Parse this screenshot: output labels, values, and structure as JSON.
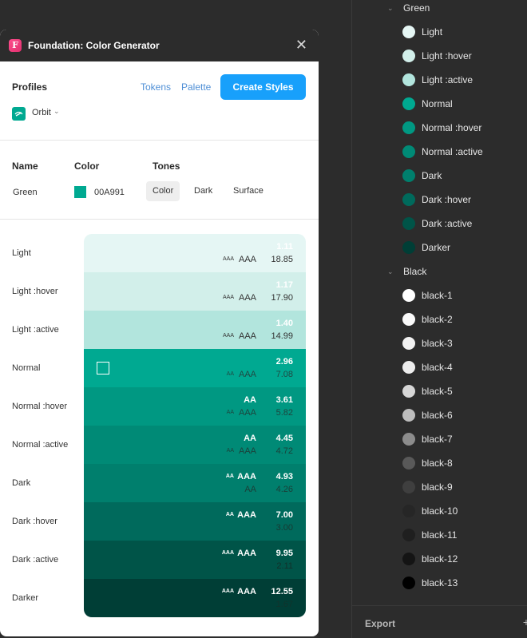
{
  "plugin": {
    "title": "Foundation: Color Generator",
    "logo_letter": "F",
    "close_glyph": "✕",
    "profiles_label": "Profiles",
    "tokens_link": "Tokens",
    "palette_link": "Palette",
    "create_styles_button": "Create Styles",
    "profile_value": "Orbit",
    "headers": {
      "name": "Name",
      "color": "Color",
      "tones": "Tones"
    },
    "color_entry": {
      "name": "Green",
      "hex": "00A991",
      "swatch_color": "#00A991"
    },
    "tone_tabs": [
      {
        "label": "Color",
        "active": true
      },
      {
        "label": "Dark",
        "active": false
      },
      {
        "label": "Surface",
        "active": false
      }
    ],
    "tones": [
      {
        "label": "Light",
        "bg": "#e5f6f4",
        "top_badge_sm": "",
        "top_badge_lg": "",
        "ratio_top": "1.11",
        "bot_badge_sm": "AAA",
        "bot_badge_lg": "AAA",
        "ratio_bottom": "18.85",
        "top_color": "#ffffff",
        "bottom_color": "#333333"
      },
      {
        "label": "Light :hover",
        "bg": "#d2efea",
        "top_badge_sm": "",
        "top_badge_lg": "",
        "ratio_top": "1.17",
        "bot_badge_sm": "AAA",
        "bot_badge_lg": "AAA",
        "ratio_bottom": "17.90",
        "top_color": "#ffffff",
        "bottom_color": "#333333"
      },
      {
        "label": "Light :active",
        "bg": "#b2e5dd",
        "top_badge_sm": "",
        "top_badge_lg": "",
        "ratio_top": "1.40",
        "bot_badge_sm": "AAA",
        "bot_badge_lg": "AAA",
        "ratio_bottom": "14.99",
        "top_color": "#ffffff",
        "bottom_color": "#333333"
      },
      {
        "label": "Normal",
        "bg": "#00a991",
        "top_badge_sm": "",
        "top_badge_lg": "",
        "ratio_top": "2.96",
        "bot_badge_sm": "AA",
        "bot_badge_lg": "AAA",
        "ratio_bottom": "7.08",
        "top_color": "#ffffff",
        "bottom_color": "#1f4a44",
        "selected": true
      },
      {
        "label": "Normal :hover",
        "bg": "#009882",
        "top_badge_sm": "",
        "top_badge_lg": "AA",
        "ratio_top": "3.61",
        "bot_badge_sm": "AA",
        "bot_badge_lg": "AAA",
        "ratio_bottom": "5.82",
        "top_color": "#ffffff",
        "bottom_color": "#1d463f"
      },
      {
        "label": "Normal :active",
        "bg": "#008a76",
        "top_badge_sm": "",
        "top_badge_lg": "AA",
        "ratio_top": "4.45",
        "bot_badge_sm": "AA",
        "bot_badge_lg": "AAA",
        "ratio_bottom": "4.72",
        "top_color": "#ffffff",
        "bottom_color": "#1b423b"
      },
      {
        "label": "Dark",
        "bg": "#007f6d",
        "top_badge_sm": "AA",
        "top_badge_lg": "AAA",
        "ratio_top": "4.93",
        "bot_badge_sm": "",
        "bot_badge_lg": "AA",
        "ratio_bottom": "4.26",
        "top_color": "#ffffff",
        "bottom_color": "#1a3f38"
      },
      {
        "label": "Dark :hover",
        "bg": "#006a5c",
        "top_badge_sm": "AA",
        "top_badge_lg": "AAA",
        "ratio_top": "7.00",
        "bot_badge_sm": "",
        "bot_badge_lg": "",
        "ratio_bottom": "3.00",
        "top_color": "#ffffff",
        "bottom_color": "#173a33"
      },
      {
        "label": "Dark :active",
        "bg": "#005448",
        "top_badge_sm": "AAA",
        "top_badge_lg": "AAA",
        "ratio_top": "9.95",
        "bot_badge_sm": "",
        "bot_badge_lg": "",
        "ratio_bottom": "2.11",
        "top_color": "#ffffff",
        "bottom_color": "#12302a"
      },
      {
        "label": "Darker",
        "bg": "#003e36",
        "top_badge_sm": "AAA",
        "top_badge_lg": "AAA",
        "ratio_top": "12.55",
        "bot_badge_sm": "",
        "bot_badge_lg": "",
        "ratio_bottom": "1.67",
        "top_color": "#ffffff",
        "bottom_color": "#10332c"
      }
    ]
  },
  "styles_panel": {
    "groups": [
      {
        "name": "Green",
        "chevron": "⌄",
        "items": [
          {
            "label": "Light",
            "color": "#e5f6f4"
          },
          {
            "label": "Light :hover",
            "color": "#d2efea"
          },
          {
            "label": "Light :active",
            "color": "#b2e5dd"
          },
          {
            "label": "Normal",
            "color": "#00a991"
          },
          {
            "label": "Normal :hover",
            "color": "#009882"
          },
          {
            "label": "Normal :active",
            "color": "#008a76"
          },
          {
            "label": "Dark",
            "color": "#007f6d"
          },
          {
            "label": "Dark :hover",
            "color": "#006a5c"
          },
          {
            "label": "Dark :active",
            "color": "#005448"
          },
          {
            "label": "Darker",
            "color": "#003e36"
          }
        ]
      },
      {
        "name": "Black",
        "chevron": "⌄",
        "items": [
          {
            "label": "black-1",
            "color": "#ffffff"
          },
          {
            "label": "black-2",
            "color": "#fafafa"
          },
          {
            "label": "black-3",
            "color": "#f2f2f2"
          },
          {
            "label": "black-4",
            "color": "#ededed"
          },
          {
            "label": "black-5",
            "color": "#d6d6d6"
          },
          {
            "label": "black-6",
            "color": "#bdbdbd"
          },
          {
            "label": "black-7",
            "color": "#8c8c8c"
          },
          {
            "label": "black-8",
            "color": "#595959"
          },
          {
            "label": "black-9",
            "color": "#3f3f3f"
          },
          {
            "label": "black-10",
            "color": "#262626"
          },
          {
            "label": "black-11",
            "color": "#1f1f1f"
          },
          {
            "label": "black-12",
            "color": "#141414"
          },
          {
            "label": "black-13",
            "color": "#000000"
          }
        ]
      }
    ],
    "export_label": "Export",
    "export_plus": "+"
  }
}
